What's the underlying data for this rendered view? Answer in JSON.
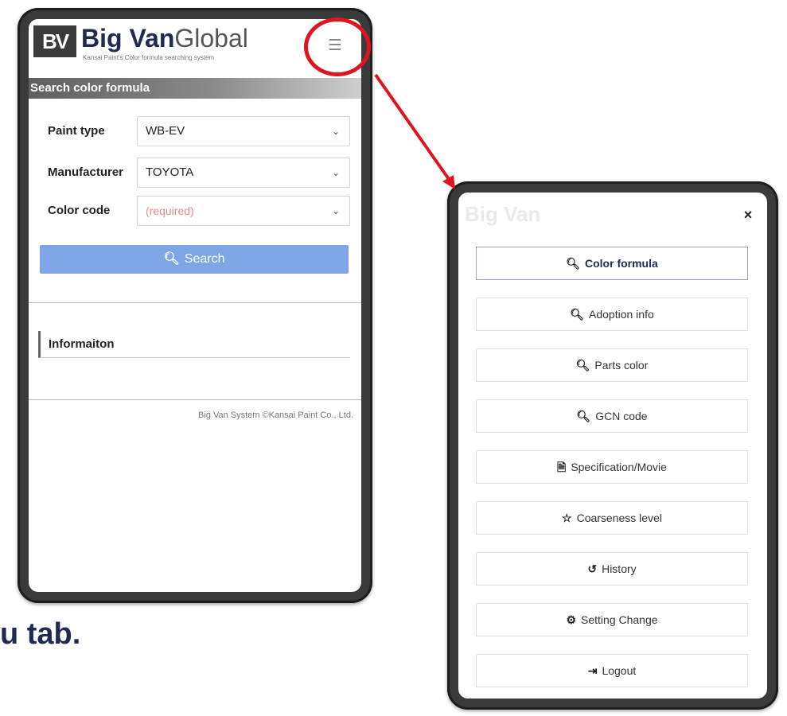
{
  "app": {
    "logo_mark": "BV",
    "logo_bold": "Big Van",
    "logo_light": "Global",
    "logo_sub": "Kansai Paint's Color formula searching system"
  },
  "search": {
    "section_title": "Search color formula",
    "paint_type_label": "Paint type",
    "paint_type_value": "WB-EV",
    "manufacturer_label": "Manufacturer",
    "manufacturer_value": "TOYOTA",
    "color_code_label": "Color code",
    "color_code_placeholder": "(required)",
    "search_button": "Search"
  },
  "info": {
    "heading": "Informaiton"
  },
  "footer": {
    "copyright": "Big Van System ©Kansai Paint Co., Ltd."
  },
  "menu": {
    "faded_logo": "Big Van",
    "close": "×",
    "items": [
      {
        "label": "Color formula",
        "icon": "search-icon",
        "glyph": "🔍︎"
      },
      {
        "label": "Adoption info",
        "icon": "search-icon",
        "glyph": "🔍︎"
      },
      {
        "label": "Parts color",
        "icon": "search-icon",
        "glyph": "🔍︎"
      },
      {
        "label": "GCN code",
        "icon": "search-icon",
        "glyph": "🔍︎"
      },
      {
        "label": "Specification/Movie",
        "icon": "file-icon",
        "glyph": "🗎"
      },
      {
        "label": "Coarseness level",
        "icon": "star-icon",
        "glyph": "☆"
      },
      {
        "label": "History",
        "icon": "history-icon",
        "glyph": "↺"
      },
      {
        "label": "Setting Change",
        "icon": "gear-icon",
        "glyph": "⚙"
      },
      {
        "label": "Logout",
        "icon": "logout-icon",
        "glyph": "⇥"
      }
    ]
  },
  "caption": "u tab.",
  "colors": {
    "accent": "#1f2a55",
    "search_button": "#7ea6e6",
    "highlight": "#e0141c"
  }
}
